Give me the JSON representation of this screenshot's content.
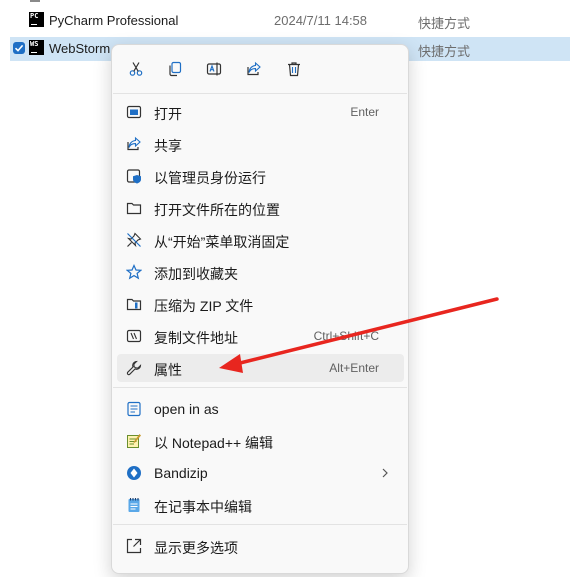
{
  "files": [
    {
      "name": "PyCharm Professional",
      "date": "2024/7/11 14:58",
      "type": "快捷方式",
      "icon_text": "PC"
    },
    {
      "name": "WebStorm",
      "date": "",
      "type": "快捷方式",
      "icon_text": "WS"
    }
  ],
  "menu": {
    "toolbar": [
      "cut-icon",
      "copy-icon",
      "rename-icon",
      "share-icon",
      "delete-icon"
    ],
    "items": [
      {
        "label": "打开",
        "shortcut": "Enter",
        "icon": "open-icon"
      },
      {
        "label": "共享",
        "shortcut": "",
        "icon": "share-icon"
      },
      {
        "label": "以管理员身份运行",
        "shortcut": "",
        "icon": "admin-shield-icon"
      },
      {
        "label": "打开文件所在的位置",
        "shortcut": "",
        "icon": "folder-icon"
      },
      {
        "label": "从“开始”菜单取消固定",
        "shortcut": "",
        "icon": "unpin-icon"
      },
      {
        "label": "添加到收藏夹",
        "shortcut": "",
        "icon": "star-icon"
      },
      {
        "label": "压缩为 ZIP 文件",
        "shortcut": "",
        "icon": "zip-icon"
      },
      {
        "label": "复制文件地址",
        "shortcut": "Ctrl+Shift+C",
        "icon": "copy-path-icon"
      },
      {
        "label": "属性",
        "shortcut": "Alt+Enter",
        "icon": "wrench-icon"
      },
      {
        "label": "open in as",
        "shortcut": "",
        "icon": "document-icon"
      },
      {
        "label": "以 Notepad++ 编辑",
        "shortcut": "",
        "icon": "notepadpp-icon"
      },
      {
        "label": "Bandizip",
        "shortcut": "",
        "icon": "bandizip-icon"
      },
      {
        "label": "在记事本中编辑",
        "shortcut": "",
        "icon": "notepad-icon"
      },
      {
        "label": "显示更多选项",
        "shortcut": "",
        "icon": "more-options-icon"
      }
    ]
  },
  "colors": {
    "accent": "#1f6fc5",
    "arrow": "#e8261f",
    "selection": "#cfe4f5"
  }
}
